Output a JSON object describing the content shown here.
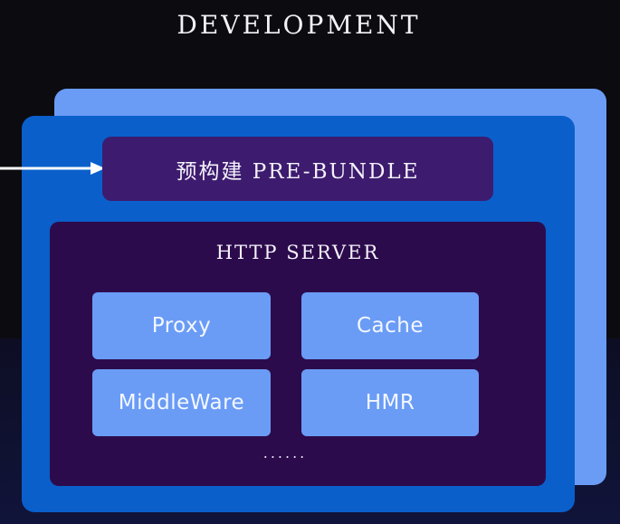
{
  "diagram": {
    "title": "DEVELOPMENT",
    "prebundle_label": "预构建 PRE-BUNDLE",
    "server": {
      "title": "HTTP SERVER",
      "modules": [
        "Proxy",
        "Cache",
        "MiddleWare",
        "HMR"
      ],
      "more": "......"
    }
  },
  "colors": {
    "background": "#0c0b10",
    "back_panel": "#6a9cf6",
    "front_panel": "#0a5fcb",
    "prebundle_box": "#3d1b6e",
    "server_box": "#2c0b4c",
    "module_box": "#6a9cf6",
    "arrow": "#ffffff"
  }
}
